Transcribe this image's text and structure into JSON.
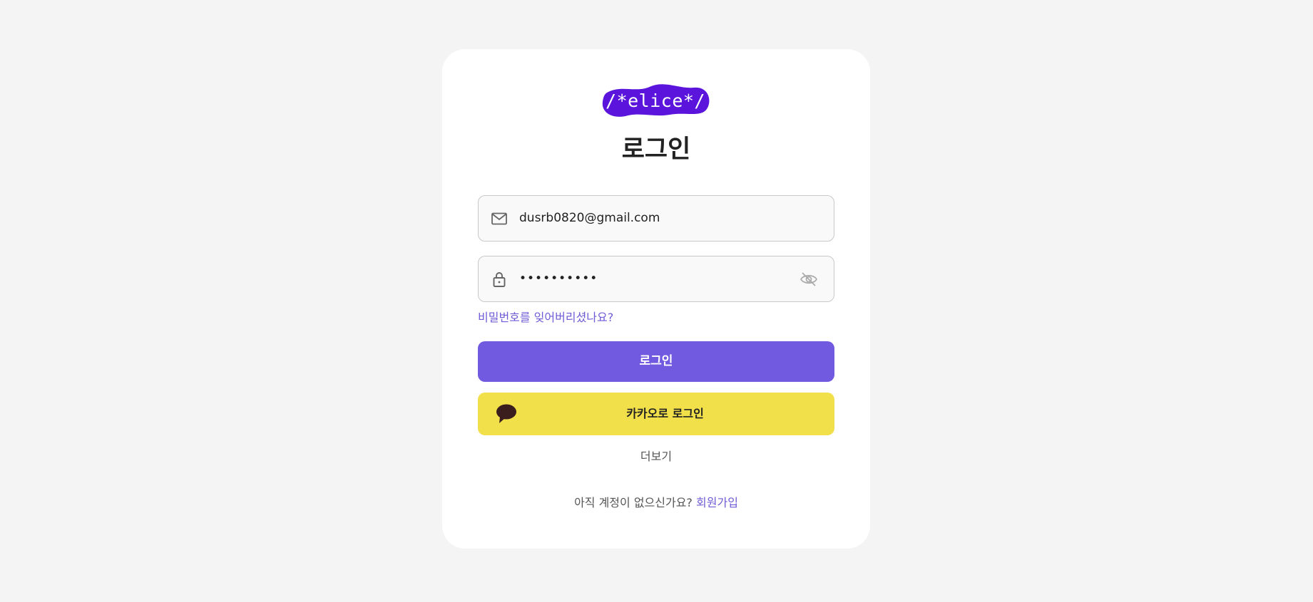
{
  "logo": {
    "text": "/*elice*/",
    "color": "#5a14dc"
  },
  "title": "로그인",
  "email": {
    "value": "dusrb0820@gmail.com",
    "icon": "mail-icon"
  },
  "password": {
    "value": "••••••••••",
    "icon": "lock-icon",
    "toggle_icon": "eye-off-icon"
  },
  "forgot_password": "비밀번호를 잊어버리셨나요?",
  "login_button": "로그인",
  "kakao_button": {
    "label": "카카오로 로그인",
    "icon": "kakao-chat-icon"
  },
  "more": "더보기",
  "signup": {
    "prompt": "아직 계정이 없으신가요?",
    "link": "회원가입"
  },
  "colors": {
    "accent": "#7159e0",
    "kakao": "#f1e04a",
    "link": "#6f5bd6",
    "background": "#f4f4f4"
  }
}
